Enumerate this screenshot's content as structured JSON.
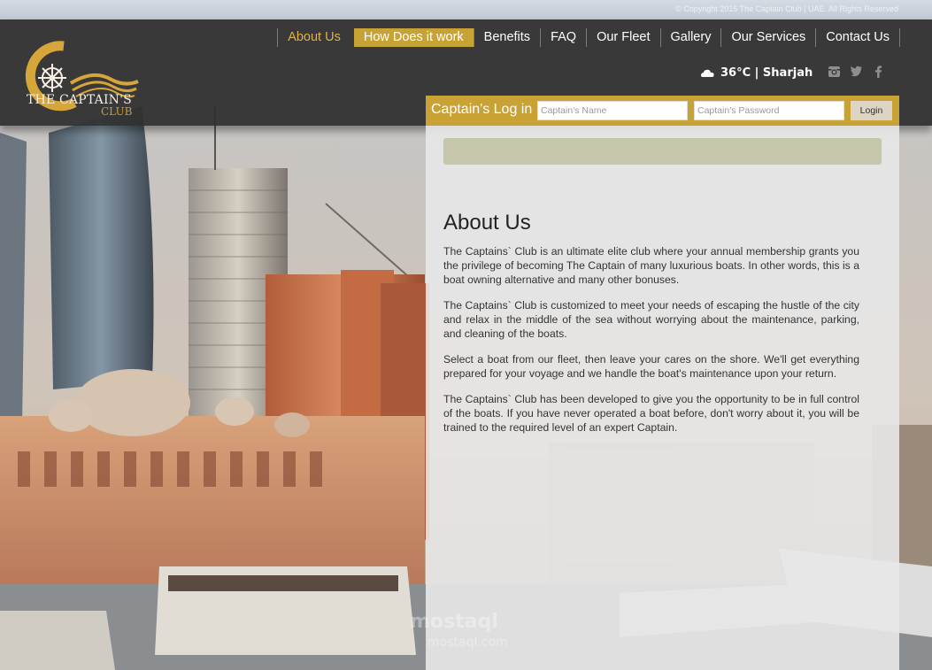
{
  "copyright": "© Copyright 2015 The Captain Club | UAE. All Rights Reserved",
  "logo": {
    "title": "THE CAPTAIN'S",
    "subtitle": "CLUB"
  },
  "nav": [
    {
      "label": "About Us",
      "state": "active"
    },
    {
      "label": "How Does it work",
      "state": "highlight"
    },
    {
      "label": "Benefits",
      "state": "normal"
    },
    {
      "label": "FAQ",
      "state": "normal"
    },
    {
      "label": "Our Fleet",
      "state": "normal"
    },
    {
      "label": "Gallery",
      "state": "normal"
    },
    {
      "label": "Our Services",
      "state": "normal"
    },
    {
      "label": "Contact Us",
      "state": "normal"
    }
  ],
  "weather": {
    "text": "36°C | Sharjah",
    "icon": "cloud-icon"
  },
  "social": [
    "instagram-icon",
    "twitter-icon",
    "facebook-icon"
  ],
  "login": {
    "label": "Captain's Log in",
    "name_placeholder": "Captain's Name",
    "password_placeholder": "Captain's Password",
    "button": "Login"
  },
  "about": {
    "title": "About Us",
    "paragraphs": [
      "The Captains` Club is an ultimate elite club where your annual membership grants you the privilege of becoming The Captain of many luxurious boats. In other words, this is a boat owning alternative and many other bonuses.",
      "The Captains` Club is customized to meet your needs of escaping the hustle of the city and relax in the middle of the sea without worrying about the maintenance, parking, and cleaning of the boats.",
      "Select a boat from our fleet, then leave your cares on the shore. We'll get everything prepared for your voyage and we handle the boat's maintenance upon your return.",
      "The Captains` Club has been developed to give you the opportunity to be in full control of the boats. If you have never operated a boat before, don't worry about it, you will be trained to the required level of an expert Captain."
    ]
  },
  "watermark": {
    "line1": "mostaql",
    "line2": "mostaql.com"
  },
  "colors": {
    "gold": "#c9a236",
    "header": "#303030",
    "active_nav": "#e0b14a"
  }
}
